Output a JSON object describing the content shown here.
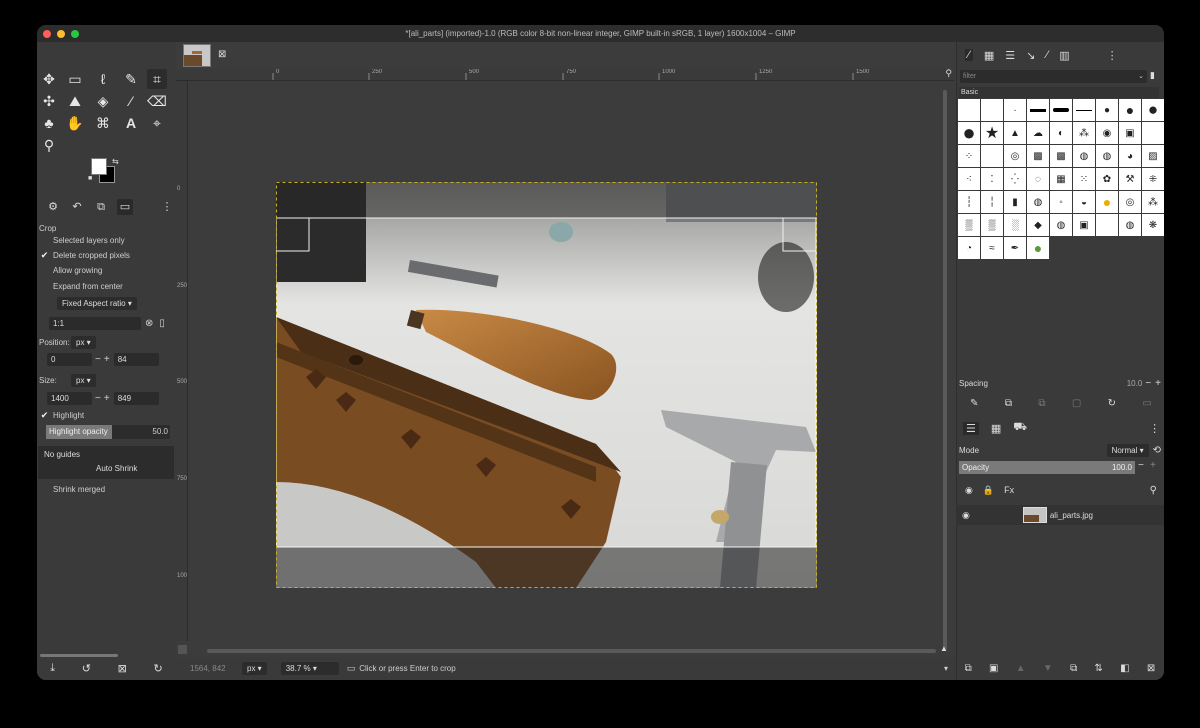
{
  "window": {
    "title": "*[ali_parts] (imported)-1.0 (RGB color 8-bit non-linear integer, GIMP built-in sRGB, 1 layer) 1600x1004 – GIMP"
  },
  "toolbox": {
    "tools": [
      "move-icon",
      "rect-select-icon",
      "lasso-icon",
      "fuzzy-select-icon",
      "crop-icon",
      "unified-transform-icon",
      "warp-icon",
      "paint-bucket-icon",
      "paintbrush-icon",
      "eraser-icon",
      "clone-icon",
      "smudge-icon",
      "path-icon",
      "text-icon",
      "color-picker-icon",
      "zoom-icon"
    ]
  },
  "tool_options": {
    "tool_name": "Crop",
    "selected_layers_only": "Selected layers only",
    "delete_cropped_pixels": "Delete cropped pixels",
    "allow_growing": "Allow growing",
    "expand_from_center": "Expand from center",
    "fixed_aspect": "Fixed Aspect ratio",
    "aspect_value": "1:1",
    "position_label": "Position:",
    "position_unit": "px",
    "position_x": "0",
    "position_y": "84",
    "size_label": "Size:",
    "size_unit": "px",
    "size_w": "1400",
    "size_h": "849",
    "highlight": "Highlight",
    "highlight_opacity_label": "Highlight opacity",
    "highlight_opacity_value": "50.0",
    "guides": "No guides",
    "auto_shrink": "Auto Shrink",
    "shrink_merged": "Shrink merged"
  },
  "canvas": {
    "ruler_ticks": [
      "0",
      "250",
      "500",
      "750",
      "1000",
      "1250",
      "1500"
    ],
    "vruler_ticks": [
      "0",
      "250",
      "500",
      "750",
      "1000"
    ]
  },
  "statusbar": {
    "coords": "1564, 842",
    "unit": "px",
    "zoom": "38.7 %",
    "message": "Click or press Enter to crop"
  },
  "brushes": {
    "filter_placeholder": "filter",
    "category_label": "Basic",
    "spacing_label": "Spacing",
    "spacing_value": "10.0"
  },
  "layers": {
    "mode_label": "Mode",
    "mode_value": "Normal",
    "opacity_label": "Opacity",
    "opacity_value": "100.0",
    "lock_label": "Lock:",
    "layer_name": "ali_parts.jpg"
  }
}
